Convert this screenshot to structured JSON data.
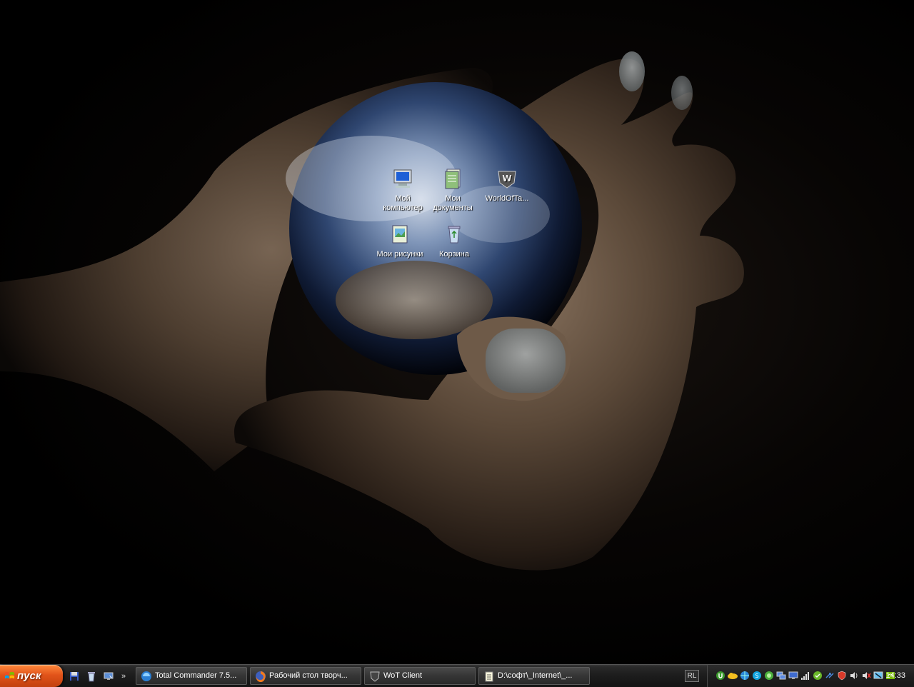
{
  "desktop": {
    "icons": [
      {
        "label": "Мой компьютер",
        "icon": "my-computer-icon"
      },
      {
        "label": "Мои документы",
        "icon": "my-documents-icon"
      },
      {
        "label": "WorldOfTa...",
        "icon": "world-of-tanks-icon"
      },
      {
        "label": "Мои рисунки",
        "icon": "my-pictures-icon"
      },
      {
        "label": "Корзина",
        "icon": "recycle-bin-icon"
      }
    ]
  },
  "taskbar": {
    "start_label": "пуск",
    "quicklaunch_more": "»",
    "tasks": [
      {
        "label": "Total Commander 7.5...",
        "icon": "total-commander-icon"
      },
      {
        "label": "Рабочий стол творч...",
        "icon": "firefox-icon"
      },
      {
        "label": "WoT Client",
        "icon": "wot-client-icon"
      },
      {
        "label": "D:\\софт\\_Internet\\_...",
        "icon": "notepad-icon"
      }
    ],
    "language": "RL",
    "clock": "14:33"
  },
  "colors": {
    "start_orange": "#e2541a",
    "taskbar_dark": "#1c1c1c"
  }
}
